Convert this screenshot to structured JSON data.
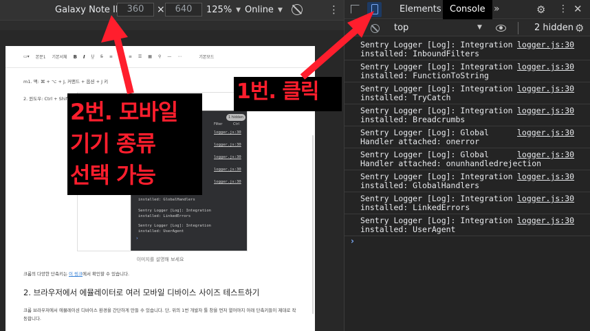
{
  "device_toolbar": {
    "device": "Galaxy Note II",
    "width": "360",
    "times": "×",
    "height": "640",
    "zoom": "125%",
    "network": "Online"
  },
  "phone": {
    "toolbar": {
      "style": "본문1",
      "font": "기본서체",
      "bold": "B",
      "italic": "I",
      "mode": "기본모드"
    },
    "line_mac": "m1. 맥: ⌘ + ⌥ + J, 커맨드 + 옵션 + J 키",
    "line_win": "2. 윈도우: Ctrl + Shift",
    "shot_logs": [
      {
        "t1": "",
        "t2": "",
        "src": "logger.js:30"
      },
      {
        "t1": "",
        "t2": "",
        "src": "logger.js:30"
      },
      {
        "t1": "",
        "t2": "",
        "src": "logger.js:30"
      },
      {
        "t1": "",
        "t2": "",
        "src": "logger.js:30"
      },
      {
        "t1": "",
        "t2": "",
        "src": "logger.js:30"
      },
      {
        "t1": "ejection",
        "t2": "",
        "src": ""
      },
      {
        "t1": "installed: GlobalHandlers",
        "t2": "",
        "src": ""
      },
      {
        "t1": "Sentry Logger [Log]: Integration",
        "t2": "installed: LinkedErrors",
        "src": ""
      },
      {
        "t1": "Sentry Logger [Log]: Integration",
        "t2": "installed: UserAgent",
        "src": ""
      }
    ],
    "shot_badge": "1 hidden",
    "shot_filter": "Filter",
    "shot_ctrl": "Ctrl",
    "caption": "이미지를 설명해 보세요",
    "link_prefix": "크롬의 다양한 단축키는 ",
    "link_text": "이 링크",
    "link_suffix": "에서 확인할 수 있습니다.",
    "heading": "2. 브라우저에서 에뮬레이터로 여러 모바일 디바이스 사이즈 테스트하기",
    "paragraph": "크롬 브라우저에서 에뮬레이션 디바이스 환경을 간단하게 만들 수 있습니다. 단, 위의 1번 개발자 툴 창을 먼저 열어야지 아래 단축키들이 제대로 작동합니다."
  },
  "annotations": {
    "callout2_lines": [
      "2번. 모바일",
      "기기 종류",
      "선택 가능"
    ],
    "callout1": "1번. 클릭",
    "color": "#ff1e2d"
  },
  "devtools": {
    "tabs": {
      "elements": "Elements",
      "console": "Console",
      "more": "»"
    },
    "context": "top",
    "hidden": "2 hidden",
    "logs": [
      {
        "t1": "Sentry Logger [Log]: Integration",
        "t2": "installed: InboundFilters",
        "src": "logger.js:30"
      },
      {
        "t1": "Sentry Logger [Log]: Integration",
        "t2": "installed: FunctionToString",
        "src": "logger.js:30"
      },
      {
        "t1": "Sentry Logger [Log]: Integration",
        "t2": "installed: TryCatch",
        "src": "logger.js:30"
      },
      {
        "t1": "Sentry Logger [Log]: Integration",
        "t2": "installed: Breadcrumbs",
        "src": "logger.js:30"
      },
      {
        "t1": "Sentry Logger [Log]: Global",
        "t2": "Handler attached: onerror",
        "src": "logger.js:30"
      },
      {
        "t1": "Sentry Logger [Log]: Global",
        "t2": "Handler attached: onunhandledrejection",
        "src": "logger.js:30"
      },
      {
        "t1": "Sentry Logger [Log]: Integration",
        "t2": "installed: GlobalHandlers",
        "src": "logger.js:30"
      },
      {
        "t1": "Sentry Logger [Log]: Integration",
        "t2": "installed: LinkedErrors",
        "src": "logger.js:30"
      },
      {
        "t1": "Sentry Logger [Log]: Integration",
        "t2": "installed: UserAgent",
        "src": "logger.js:30"
      }
    ],
    "prompt": "›",
    "icons": [
      "select-element-icon",
      "device-toolbar-icon",
      "gear-icon",
      "kebab-icon",
      "close-icon",
      "clear-console-icon",
      "eye-icon"
    ]
  }
}
